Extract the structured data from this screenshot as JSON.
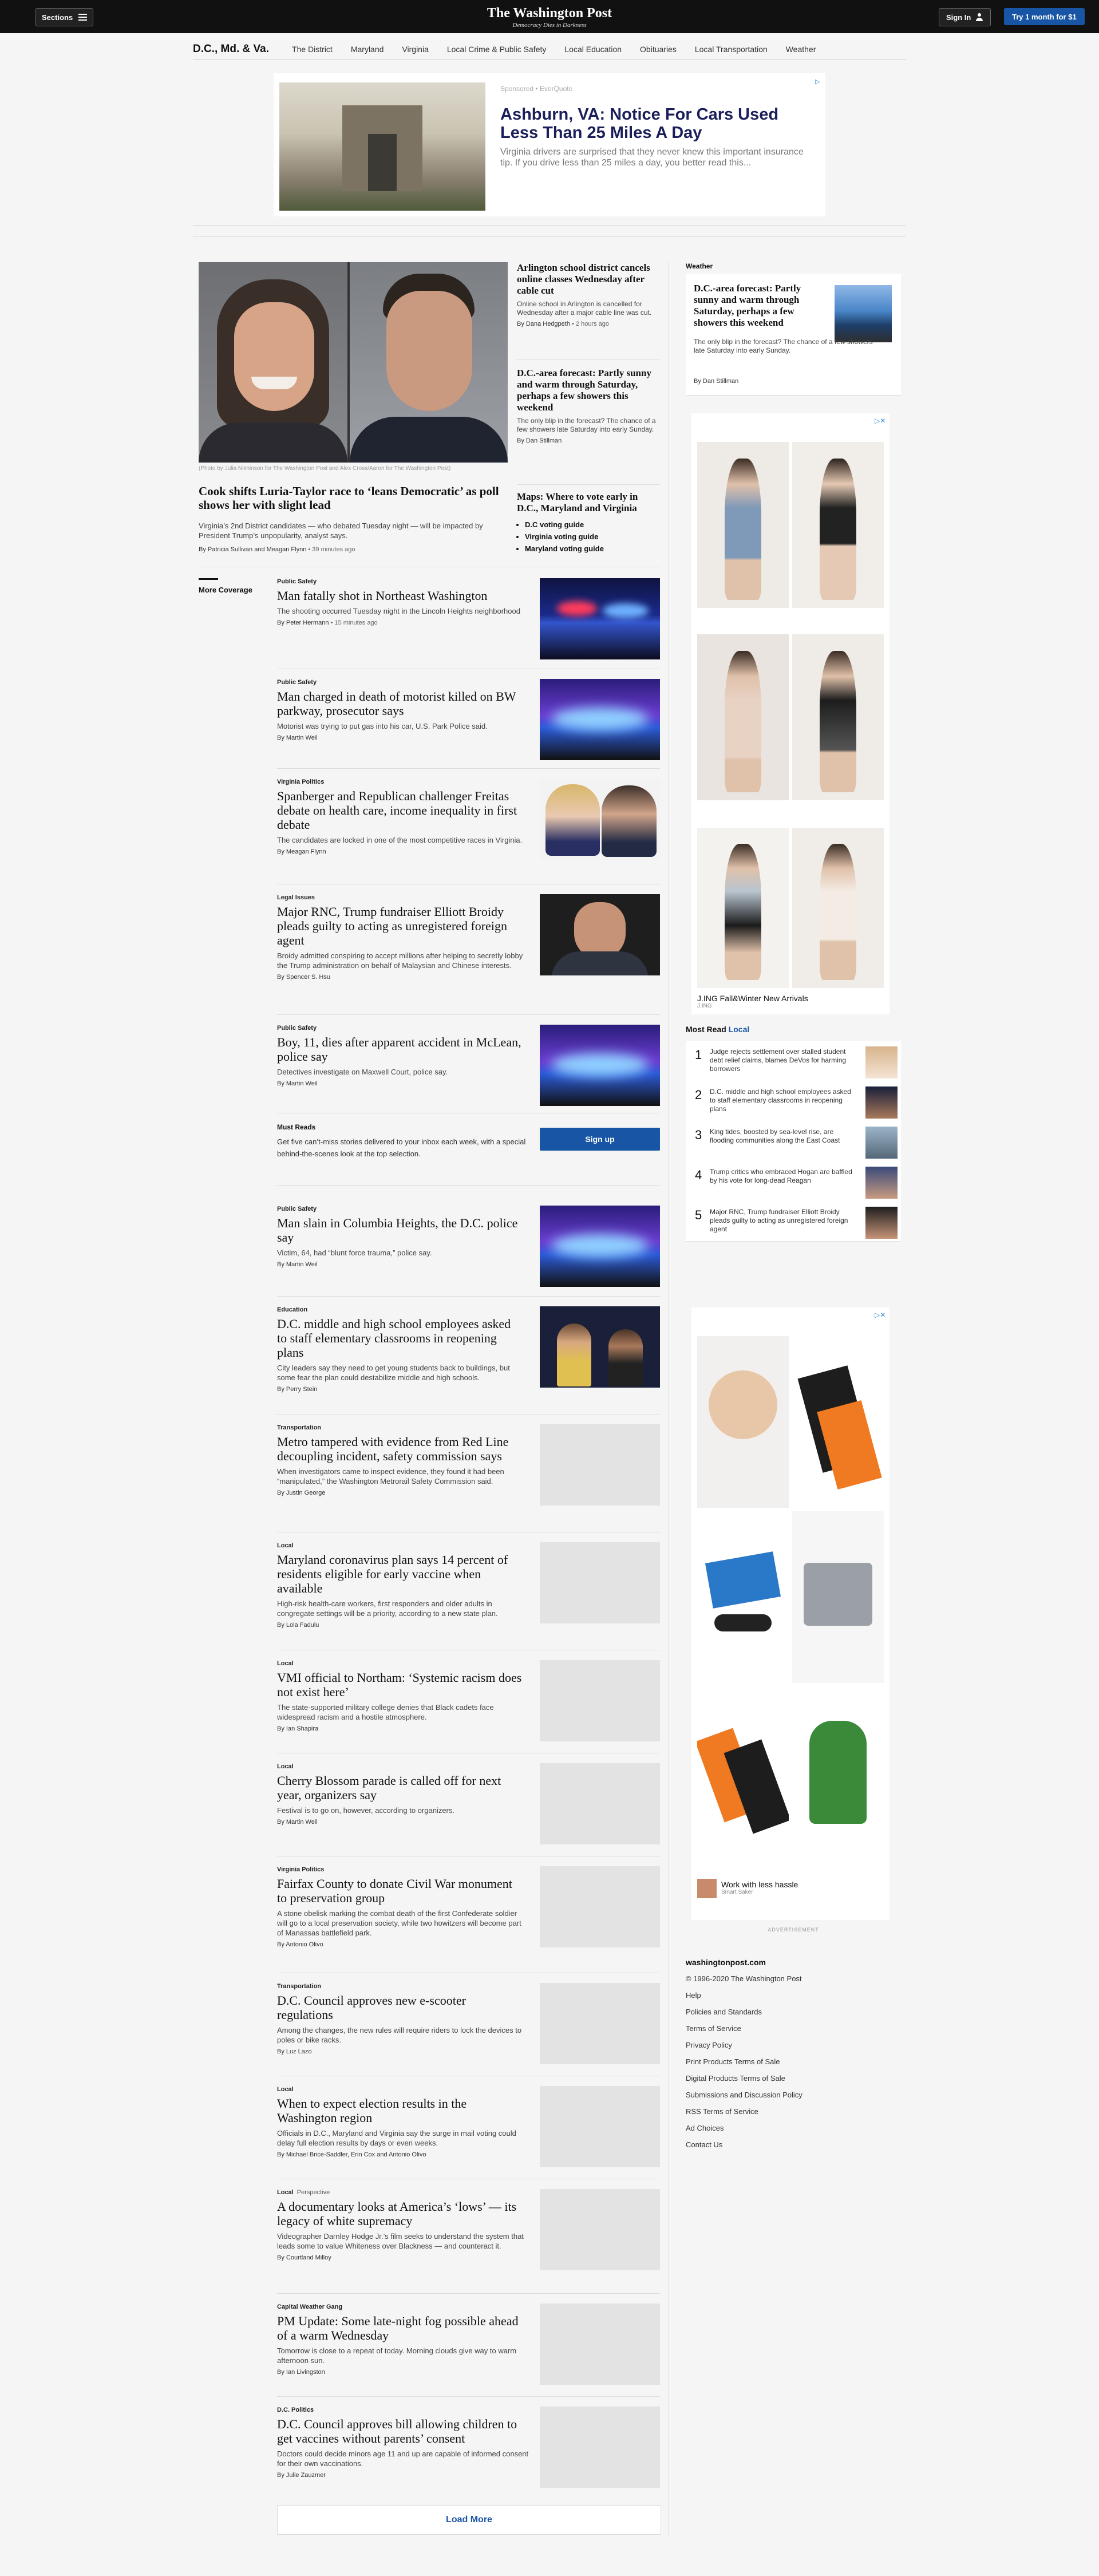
{
  "header": {
    "sections_label": "Sections",
    "logo": "The Washington Post",
    "tagline": "Democracy Dies in Darkness",
    "signin_label": "Sign In",
    "subscribe_label": "Try 1 month for $1"
  },
  "section_nav": {
    "title": "D.C., Md. & Va.",
    "items": [
      "The District",
      "Maryland",
      "Virginia",
      "Local Crime & Public Safety",
      "Local Education",
      "Obituaries",
      "Local Transportation",
      "Weather"
    ]
  },
  "top_ad": {
    "sponsor": "Sponsored • EverQuote",
    "title": "Ashburn, VA: Notice For Cars Used Less Than 25 Miles A Day",
    "description": "Virginia drivers are surprised that they never knew this important insurance tip. If you drive less than 25 miles a day, you better read this..."
  },
  "lead": {
    "credit": "(Photo by Julia Nikhinson for The Washington Post and Alex Cross/Aaron for The Washington Post)",
    "headline": "Cook shifts Luria-Taylor race to ‘leans Democratic’ as poll shows her with slight lead",
    "blurb": "Virginia’s 2nd District candidates — who debated Tuesday night — will be impacted by President Trump’s unpopularity, analyst says.",
    "byline": "By Patricia Sullivan and Meagan Flynn",
    "time": "39 minutes ago"
  },
  "side_stories": [
    {
      "headline": "Arlington school district cancels online classes Wednesday after cable cut",
      "blurb": "Online school in Arlington is cancelled for Wednesday after a major cable line was cut.",
      "byline": "By Dana Hedgpeth",
      "time": "2 hours ago"
    },
    {
      "headline": "D.C.-area forecast: Partly sunny and warm through Saturday, perhaps a few showers this weekend",
      "blurb": "The only blip in the forecast? The chance of a few showers late Saturday into early Sunday.",
      "byline": "By Dan Stillman"
    }
  ],
  "voting": {
    "headline": "Maps: Where to vote early in D.C., Maryland and Virginia",
    "links": [
      "D.C voting guide",
      "Virginia voting guide",
      "Maryland voting guide"
    ]
  },
  "more_coverage_label": "More Coverage",
  "feed": [
    {
      "kicker": "Public Safety",
      "headline": "Man fatally shot in Northeast Washington",
      "blurb": "The shooting occurred Tuesday night in the Lincoln Heights neighborhood",
      "byline": "By Peter Hermann",
      "time": "15 minutes ago"
    },
    {
      "kicker": "Public Safety",
      "headline": "Man charged in death of motorist killed on BW parkway, prosecutor says",
      "blurb": "Motorist was trying to put gas into his car, U.S. Park Police said.",
      "byline": "By Martin Weil"
    },
    {
      "kicker": "Virginia Politics",
      "headline": "Spanberger and Republican challenger Freitas debate on health care, income inequality in first debate",
      "blurb": "The candidates are locked in one of the most competitive races in Virginia.",
      "byline": "By Meagan Flynn"
    },
    {
      "kicker": "Legal Issues",
      "headline": "Major RNC, Trump fundraiser Elliott Broidy pleads guilty to acting as unregistered foreign agent",
      "blurb": "Broidy admitted conspiring to accept millions after helping to secretly lobby the Trump administration on behalf of Malaysian and Chinese interests.",
      "byline": "By Spencer S. Hsu"
    },
    {
      "kicker": "Public Safety",
      "headline": "Boy, 11, dies after apparent accident in McLean, police say",
      "blurb": "Detectives investigate on Maxwell Court, police say.",
      "byline": "By Martin Weil"
    },
    {
      "kicker": "Public Safety",
      "headline": "Man slain in Columbia Heights, the D.C. police say",
      "blurb": "Victim, 64, had “blunt force trauma,” police say.",
      "byline": "By Martin Weil"
    },
    {
      "kicker": "Education",
      "headline": "D.C. middle and high school employees asked to staff elementary classrooms in reopening plans",
      "blurb": "City leaders say they need to get young students back to buildings, but some fear the plan could destabilize middle and high schools.",
      "byline": "By Perry Stein"
    },
    {
      "kicker": "Transportation",
      "headline": "Metro tampered with evidence from Red Line decoupling incident, safety commission says",
      "blurb": "When investigators came to inspect evidence, they found it had been “manipulated,” the Washington Metrorail Safety Commission said.",
      "byline": "By Justin George"
    },
    {
      "kicker": "Local",
      "headline": "Maryland coronavirus plan says 14 percent of residents eligible for early vaccine when available",
      "blurb": "High-risk health-care workers, first responders and older adults in congregate settings will be a priority, according to a new state plan.",
      "byline": "By Lola Fadulu"
    },
    {
      "kicker": "Local",
      "headline": "VMI official to Northam: ‘Systemic racism does not exist here’",
      "blurb": "The state-supported military college denies that Black cadets face widespread racism and a hostile atmosphere.",
      "byline": "By Ian Shapira"
    },
    {
      "kicker": "Local",
      "headline": "Cherry Blossom parade is called off for next year, organizers say",
      "blurb": "Festival is to go on, however, according to organizers.",
      "byline": "By Martin Weil"
    },
    {
      "kicker": "Virginia Politics",
      "headline": "Fairfax County to donate Civil War monument to preservation group",
      "blurb": "A stone obelisk marking the combat death of the first Confederate soldier will go to a local preservation society, while two howitzers will become part of Manassas battlefield park.",
      "byline": "By Antonio Olivo"
    },
    {
      "kicker": "Transportation",
      "headline": "D.C. Council approves new e-scooter regulations",
      "blurb": "Among the changes, the new rules will require riders to lock the devices to poles or bike racks.",
      "byline": "By Luz Lazo"
    },
    {
      "kicker": "Local",
      "headline": "When to expect election results in the Washington region",
      "blurb": "Officials in D.C., Maryland and Virginia say the surge in mail voting could delay full election results by days or even weeks.",
      "byline": "By Michael Brice-Saddler, Erin Cox and Antonio Olivo"
    },
    {
      "kicker": "Local",
      "subkicker": "Perspective",
      "headline": "A documentary looks at America’s ‘lows’ — its legacy of white supremacy",
      "blurb": "Videographer Darnley Hodge Jr.’s film seeks to understand the system that leads some to value Whiteness over Blackness — and counteract it.",
      "byline": "By Courtland Milloy"
    },
    {
      "kicker": "Capital Weather Gang",
      "headline": "PM Update: Some late-night fog possible ahead of a warm Wednesday",
      "blurb": "Tomorrow is close to a repeat of today. Morning clouds give way to warm afternoon sun.",
      "byline": "By Ian Livingston"
    },
    {
      "kicker": "D.C. Politics",
      "headline": "D.C. Council approves bill allowing children to get vaccines without parents’ consent",
      "blurb": "Doctors could decide minors age 11 and up are capable of informed consent for their own vaccinations.",
      "byline": "By Julie Zauzmer"
    }
  ],
  "must_reads": {
    "label": "Must Reads",
    "text": "Get five can’t-miss stories delivered to your inbox each week, with a special behind-the-scenes look at the top selection.",
    "button": "Sign up"
  },
  "load_more": "Load More",
  "rail": {
    "weather_label": "Weather",
    "weather": {
      "headline": "D.C.-area forecast: Partly sunny and warm through Saturday, perhaps a few showers this weekend",
      "blurb": "The only blip in the forecast? The chance of a few showers late Saturday into early Sunday.",
      "byline": "By Dan Stillman"
    },
    "ad1_caption": "J.ING Fall&Winter New Arrivals",
    "ad1_sub": "J.ING",
    "most_read_label": "Most Read",
    "most_read_local": "Local",
    "most_read": [
      {
        "n": "1",
        "title": "Judge rejects settlement over stalled student debt relief claims, blames DeVos for harming borrowers"
      },
      {
        "n": "2",
        "title": "D.C. middle and high school employees asked to staff elementary classrooms in reopening plans"
      },
      {
        "n": "3",
        "title": "King tides, boosted by sea-level rise, are flooding communities along the East Coast"
      },
      {
        "n": "4",
        "title": "Trump critics who embraced Hogan are baffled by his vote for long-dead Reagan"
      },
      {
        "n": "5",
        "title": "Major RNC, Trump fundraiser Elliott Broidy pleads guilty to acting as unregistered foreign agent"
      }
    ],
    "ad2_caption": "Work with less hassle",
    "ad2_sub": "Smart Saker",
    "ad_label": "ADVERTISEMENT",
    "footer": {
      "site": "washingtonpost.com",
      "links": [
        "© 1996-2020 The Washington Post",
        "Help",
        "Policies and Standards",
        "Terms of Service",
        "Privacy Policy",
        "Print Products Terms of Sale",
        "Digital Products Terms of Sale",
        "Submissions and Discussion Policy",
        "RSS Terms of Service",
        "Ad Choices",
        "Contact Us"
      ]
    }
  },
  "colors": {
    "accent": "#1955a5",
    "topbar": "#111111",
    "background": "#f5f5f5"
  }
}
